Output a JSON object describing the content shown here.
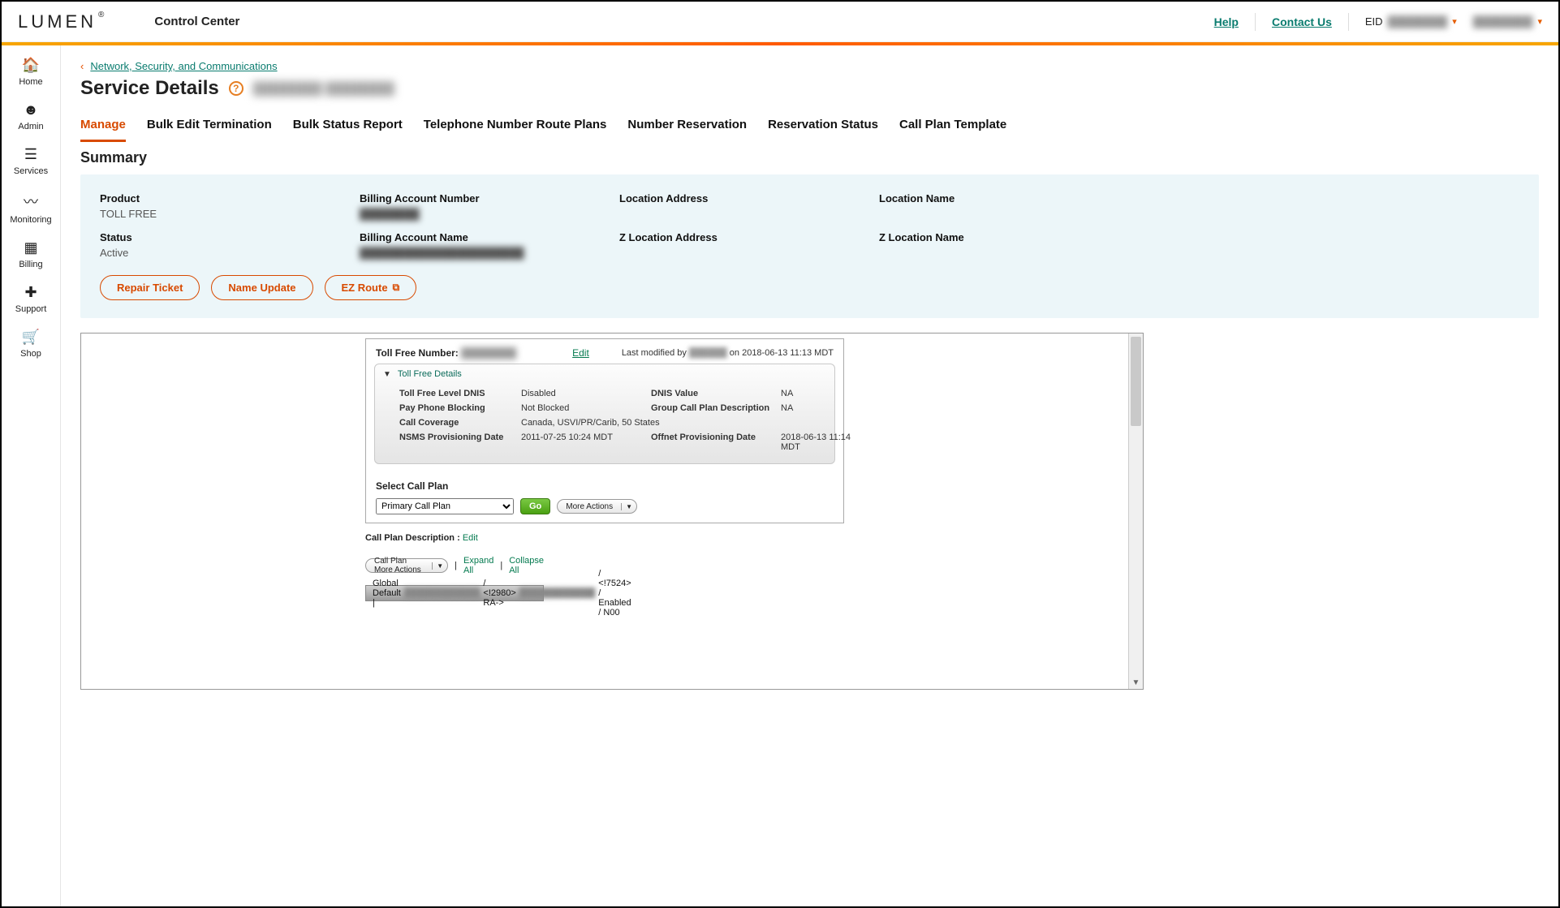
{
  "header": {
    "logo": "LUMEN",
    "logo_reg": "®",
    "app_title": "Control Center",
    "help": "Help",
    "contact": "Contact Us",
    "eid_label": "EID",
    "eid_value": "████████",
    "user_value": "████████"
  },
  "sidebar": [
    {
      "icon": "⌂",
      "label": "Home"
    },
    {
      "icon": "☺",
      "label": "Admin"
    },
    {
      "icon": "≣",
      "label": "Services"
    },
    {
      "icon": "〜",
      "label": "Monitoring"
    },
    {
      "icon": "▤",
      "label": "Billing"
    },
    {
      "icon": "✿",
      "label": "Support"
    },
    {
      "icon": "🛒",
      "label": "Shop"
    }
  ],
  "breadcrumb": {
    "text": "Network, Security, and Communications"
  },
  "page": {
    "title": "Service Details",
    "sub_blur": "████████   ████████"
  },
  "tabs": [
    "Manage",
    "Bulk Edit Termination",
    "Bulk Status Report",
    "Telephone Number Route Plans",
    "Number Reservation",
    "Reservation Status",
    "Call Plan Template"
  ],
  "active_tab": "Manage",
  "summary_heading": "Summary",
  "summary": {
    "product_lbl": "Product",
    "product_val": "TOLL FREE",
    "ban_lbl": "Billing Account Number",
    "ban_val": "████████",
    "loc_addr_lbl": "Location Address",
    "loc_addr_val": "",
    "loc_name_lbl": "Location Name",
    "loc_name_val": "",
    "status_lbl": "Status",
    "status_val": "Active",
    "ban_name_lbl": "Billing Account Name",
    "ban_name_val": "██████████████████████",
    "zloc_addr_lbl": "Z Location Address",
    "zloc_name_lbl": "Z Location Name"
  },
  "buttons": {
    "repair": "Repair Ticket",
    "name_update": "Name Update",
    "ez_route": "EZ Route"
  },
  "toll": {
    "tfn_lbl": "Toll Free Number:",
    "tfn_val": "████████",
    "edit": "Edit",
    "last_mod_pre": "Last modified by ",
    "last_mod_by": "██████",
    "last_mod_post": " on 2018-06-13 11:13 MDT",
    "details_title": "Toll Free Details",
    "rows": {
      "tfl_dnis_k": "Toll Free Level DNIS",
      "tfl_dnis_v": "Disabled",
      "dnis_val_k": "DNIS Value",
      "dnis_val_v": "NA",
      "pay_k": "Pay Phone Blocking",
      "pay_v": "Not Blocked",
      "grp_k": "Group Call Plan Description",
      "grp_v": "NA",
      "cov_k": "Call Coverage",
      "cov_v": "Canada, USVI/PR/Carib, 50 States",
      "nsms_k": "NSMS Provisioning Date",
      "nsms_v": "2011-07-25 10:24 MDT",
      "off_k": "Offnet Provisioning Date",
      "off_v": "2018-06-13 11:14 MDT"
    },
    "select_lbl": "Select Call Plan",
    "select_val": "Primary Call Plan",
    "go": "Go",
    "more_actions": "More Actions"
  },
  "below": {
    "cpd_lbl": "Call Plan Description : ",
    "cpd_edit": "Edit",
    "cp_more": "Call Plan More Actions",
    "expand": "Expand All",
    "collapse": "Collapse All",
    "global_pre": "Global Default | ",
    "global_mid_a": " / <!2980> RA-> ",
    "global_mid_b": " / <!7524> / Enabled / N00"
  }
}
